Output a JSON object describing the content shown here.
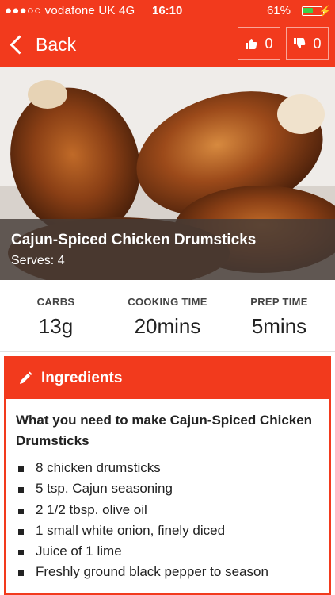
{
  "status_bar": {
    "carrier": "●●●○○ vodafone UK  4G",
    "time": "16:10",
    "battery_pct": "61%",
    "battery_level": 0.61
  },
  "nav": {
    "back_label": "Back",
    "likes": "0",
    "dislikes": "0"
  },
  "colors": {
    "accent": "#f23a1d",
    "battery_green": "#39d14a"
  },
  "recipe": {
    "title": "Cajun-Spiced Chicken Drumsticks",
    "serves": "Serves: 4"
  },
  "stats": [
    {
      "label": "CARBS",
      "value": "13g"
    },
    {
      "label": "COOKING TIME",
      "value": "20mins"
    },
    {
      "label": "PREP TIME",
      "value": "5mins"
    }
  ],
  "ingredients": {
    "header": "Ingredients",
    "icon": "pencil-icon",
    "intro": "What you need to make Cajun-Spiced Chicken Drumsticks",
    "items": [
      "8 chicken drumsticks",
      "5 tsp. Cajun seasoning",
      "2 1/2 tbsp. olive oil",
      "1 small white onion, finely diced",
      "Juice of 1 lime",
      "Freshly ground black pepper to season"
    ]
  }
}
